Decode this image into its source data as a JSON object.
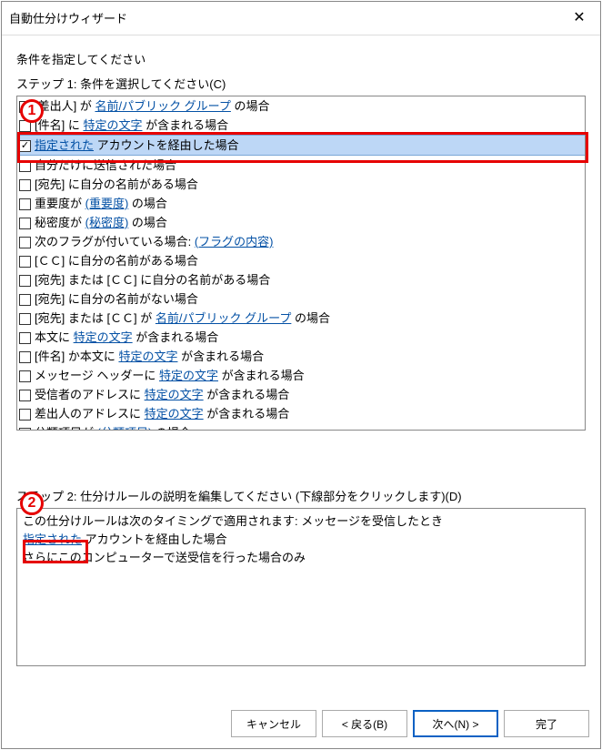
{
  "window": {
    "title": "自動仕分けウィザード"
  },
  "instruction": "条件を指定してください",
  "step1_label": "ステップ 1: 条件を選択してください(C)",
  "conditions": [
    {
      "pre": "[差出人] が ",
      "link": "名前/パブリック グループ",
      "post": " の場合",
      "checked": false
    },
    {
      "pre": "[件名] に ",
      "link": "特定の文字",
      "post": " が含まれる場合",
      "checked": false
    },
    {
      "pre": "",
      "link": "指定された",
      "post": " アカウントを経由した場合",
      "checked": true
    },
    {
      "pre": "自分だけに送信された場合",
      "link": "",
      "post": "",
      "checked": false
    },
    {
      "pre": "[宛先] に自分の名前がある場合",
      "link": "",
      "post": "",
      "checked": false
    },
    {
      "pre": "重要度が ",
      "link": "(重要度)",
      "post": " の場合",
      "checked": false
    },
    {
      "pre": "秘密度が ",
      "link": "(秘密度)",
      "post": " の場合",
      "checked": false
    },
    {
      "pre": "次のフラグが付いている場合: ",
      "link": "(フラグの内容)",
      "post": "",
      "checked": false
    },
    {
      "pre": "[ＣＣ] に自分の名前がある場合",
      "link": "",
      "post": "",
      "checked": false
    },
    {
      "pre": "[宛先] または [ＣＣ] に自分の名前がある場合",
      "link": "",
      "post": "",
      "checked": false
    },
    {
      "pre": "[宛先] に自分の名前がない場合",
      "link": "",
      "post": "",
      "checked": false
    },
    {
      "pre": "[宛先] または [ＣＣ] が ",
      "link": "名前/パブリック グループ",
      "post": " の場合",
      "checked": false
    },
    {
      "pre": "本文に ",
      "link": "特定の文字",
      "post": " が含まれる場合",
      "checked": false
    },
    {
      "pre": "[件名] か本文に ",
      "link": "特定の文字",
      "post": " が含まれる場合",
      "checked": false
    },
    {
      "pre": "メッセージ ヘッダーに ",
      "link": "特定の文字",
      "post": " が含まれる場合",
      "checked": false
    },
    {
      "pre": "受信者のアドレスに ",
      "link": "特定の文字",
      "post": " が含まれる場合",
      "checked": false
    },
    {
      "pre": "差出人のアドレスに ",
      "link": "特定の文字",
      "post": " が含まれる場合",
      "checked": false
    },
    {
      "pre": "分類項目が ",
      "link": "(分類項目)",
      "post": " の場合",
      "checked": false
    }
  ],
  "step2_label": "ステップ 2: 仕分けルールの説明を編集してください (下線部分をクリックします)(D)",
  "description": {
    "line1": "この仕分けルールは次のタイミングで適用されます: メッセージを受信したとき",
    "line2_link": "指定された",
    "line2_post": " アカウントを経由した場合",
    "line3": "さらにこのコンピューターで送受信を行った場合のみ"
  },
  "buttons": {
    "cancel": "キャンセル",
    "back": "< 戻る(B)",
    "next": "次へ(N) >",
    "finish": "完了"
  },
  "annotations": {
    "one": "1",
    "two": "2"
  }
}
